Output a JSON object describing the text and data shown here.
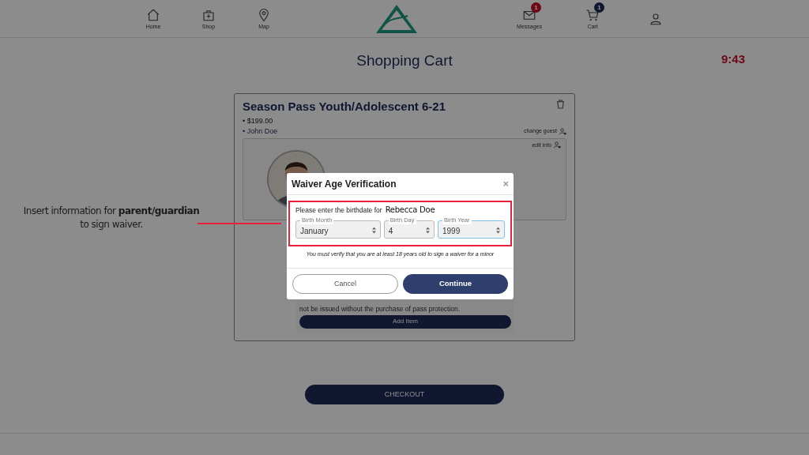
{
  "nav": {
    "left": [
      {
        "label": "Home"
      },
      {
        "label": "Shop"
      },
      {
        "label": "Map"
      }
    ],
    "right": [
      {
        "kind": "link",
        "label": "Messages",
        "badge": "1"
      },
      {
        "kind": "link",
        "label": "Cart",
        "badge": "1"
      },
      {
        "kind": "profile"
      }
    ]
  },
  "page_title": "Shopping Cart",
  "clock": "9:43",
  "cart_item": {
    "title": "Season Pass Youth/Adolescent 6-21",
    "price": "• $199.00",
    "guest": "• John Doe",
    "change_guest": "change guest",
    "edit_info": "edit info",
    "description": [
      "not be issued without the purchase of pass protection."
    ],
    "add_button": "Add Item"
  },
  "checkout": "CHECKOUT",
  "modal": {
    "title": "Waiver Age Verification",
    "close": "×",
    "prompt": "Please enter the birthdate for",
    "person": "Rebecca Doe",
    "fields": [
      {
        "label": "Birth Month",
        "value": "January",
        "focused": false
      },
      {
        "label": "Birth Day",
        "value": "4",
        "focused": false
      },
      {
        "label": "Birth Year",
        "value": "1999",
        "focused": true
      }
    ],
    "note": "You must verify that you are at least 18 years old to sign a waiver for a minor",
    "cancel": "Cancel",
    "continue": "Continue"
  },
  "annotation": {
    "text": "Insert information for **parent/guardian** to sign waiver."
  }
}
